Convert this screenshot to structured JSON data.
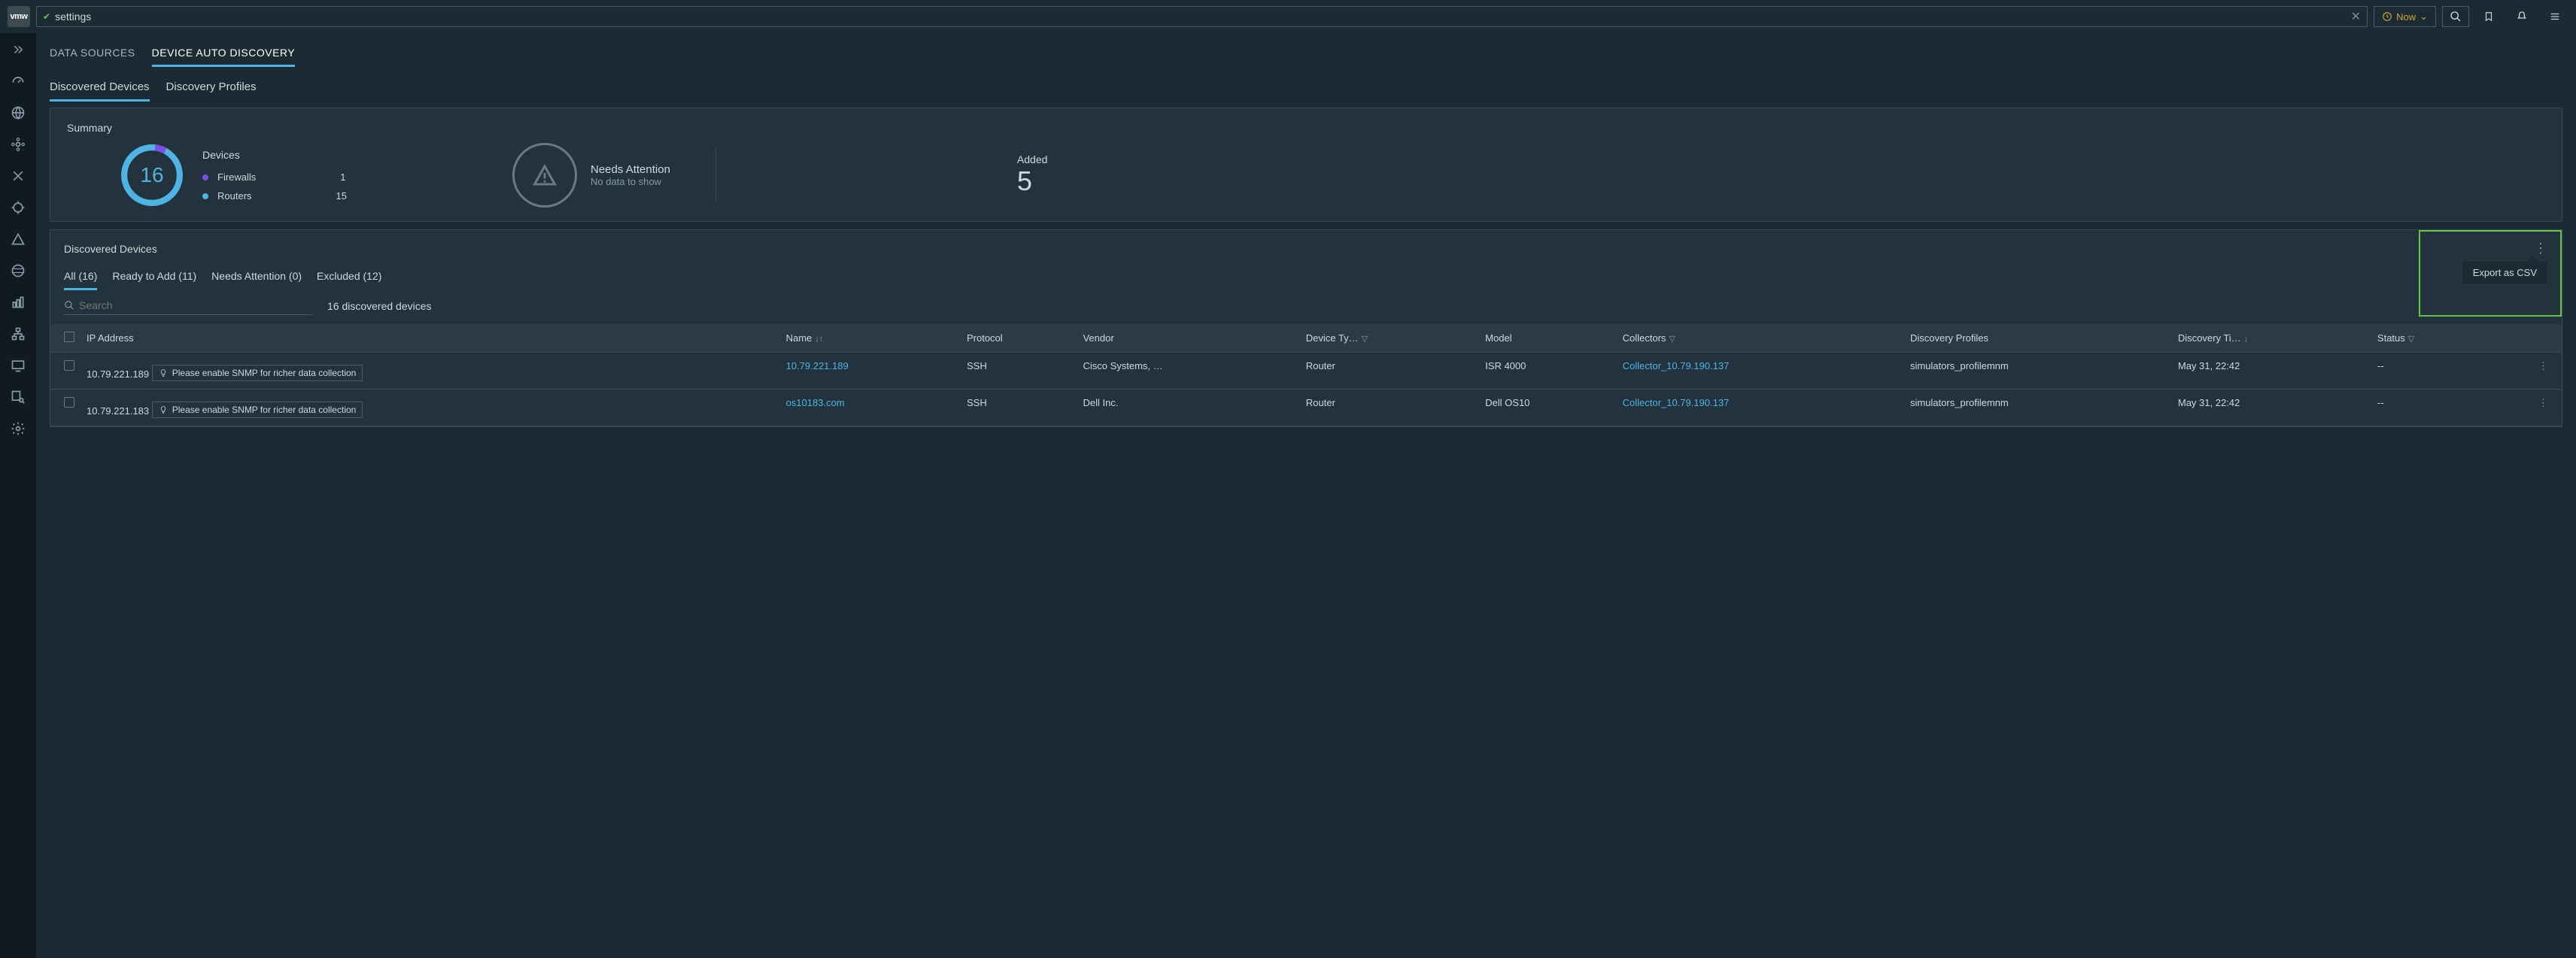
{
  "topbar": {
    "logo": "vmw",
    "search_value": "settings",
    "now_label": "Now"
  },
  "nav": {
    "top_tabs": [
      "DATA SOURCES",
      "DEVICE AUTO DISCOVERY"
    ],
    "active_top_tab": 1,
    "sub_tabs": [
      "Discovered Devices",
      "Discovery Profiles"
    ],
    "active_sub_tab": 0
  },
  "summary": {
    "title": "Summary",
    "devices_label": "Devices",
    "device_total": "16",
    "legend": [
      {
        "label": "Firewalls",
        "count": "1",
        "color": "#7b4fe4"
      },
      {
        "label": "Routers",
        "count": "15",
        "color": "#4fb3e4"
      }
    ],
    "attention_label": "Needs Attention",
    "attention_sub": "No data to show",
    "added_label": "Added",
    "added_count": "5"
  },
  "table": {
    "title": "Discovered Devices",
    "filter_tabs": [
      "All (16)",
      "Ready to Add (11)",
      "Needs Attention (0)",
      "Excluded (12)"
    ],
    "active_filter": 0,
    "search_placeholder": "Search",
    "count_text": "16 discovered devices",
    "tooltip": "Export as CSV",
    "columns": {
      "ip": "IP Address",
      "name": "Name",
      "protocol": "Protocol",
      "vendor": "Vendor",
      "device_type": "Device Ty…",
      "model": "Model",
      "collectors": "Collectors",
      "profiles": "Discovery Profiles",
      "time": "Discovery Ti…",
      "status": "Status"
    },
    "snmp_hint": "Please enable SNMP for richer data collection",
    "rows": [
      {
        "ip": "10.79.221.189",
        "name": "10.79.221.189",
        "protocol": "SSH",
        "vendor": "Cisco Systems, …",
        "device_type": "Router",
        "model": "ISR 4000",
        "collector": "Collector_10.79.190.137",
        "profile": "simulators_profilemnm",
        "time": "May 31, 22:42",
        "status": "--"
      },
      {
        "ip": "10.79.221.183",
        "name": "os10183.com",
        "protocol": "SSH",
        "vendor": "Dell Inc.",
        "device_type": "Router",
        "model": "Dell OS10",
        "collector": "Collector_10.79.190.137",
        "profile": "simulators_profilemnm",
        "time": "May 31, 22:42",
        "status": "--"
      }
    ]
  }
}
